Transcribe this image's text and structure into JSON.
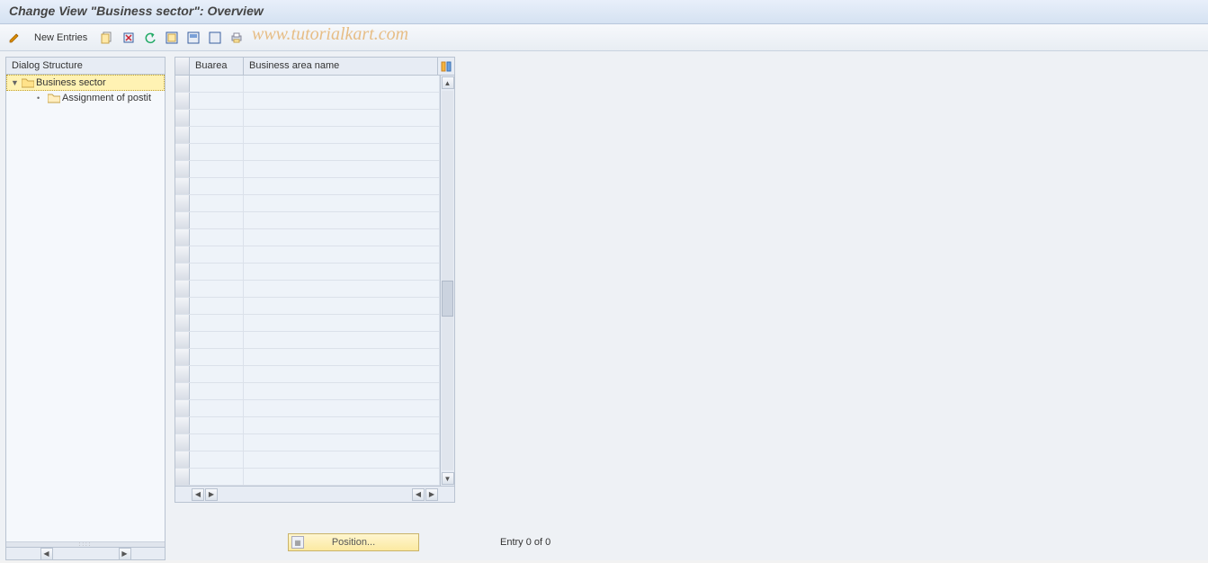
{
  "title": "Change View \"Business sector\": Overview",
  "toolbar": {
    "new_entries_label": "New Entries"
  },
  "watermark": "www.tutorialkart.com",
  "tree": {
    "header": "Dialog Structure",
    "items": [
      {
        "label": "Business sector",
        "selected": true,
        "expanded": true
      },
      {
        "label": "Assignment of postit",
        "selected": false,
        "child": true
      }
    ]
  },
  "table": {
    "columns": [
      "Buarea",
      "Business area name"
    ],
    "row_count": 24
  },
  "footer": {
    "position_label": "Position...",
    "entry_text": "Entry 0 of 0"
  }
}
